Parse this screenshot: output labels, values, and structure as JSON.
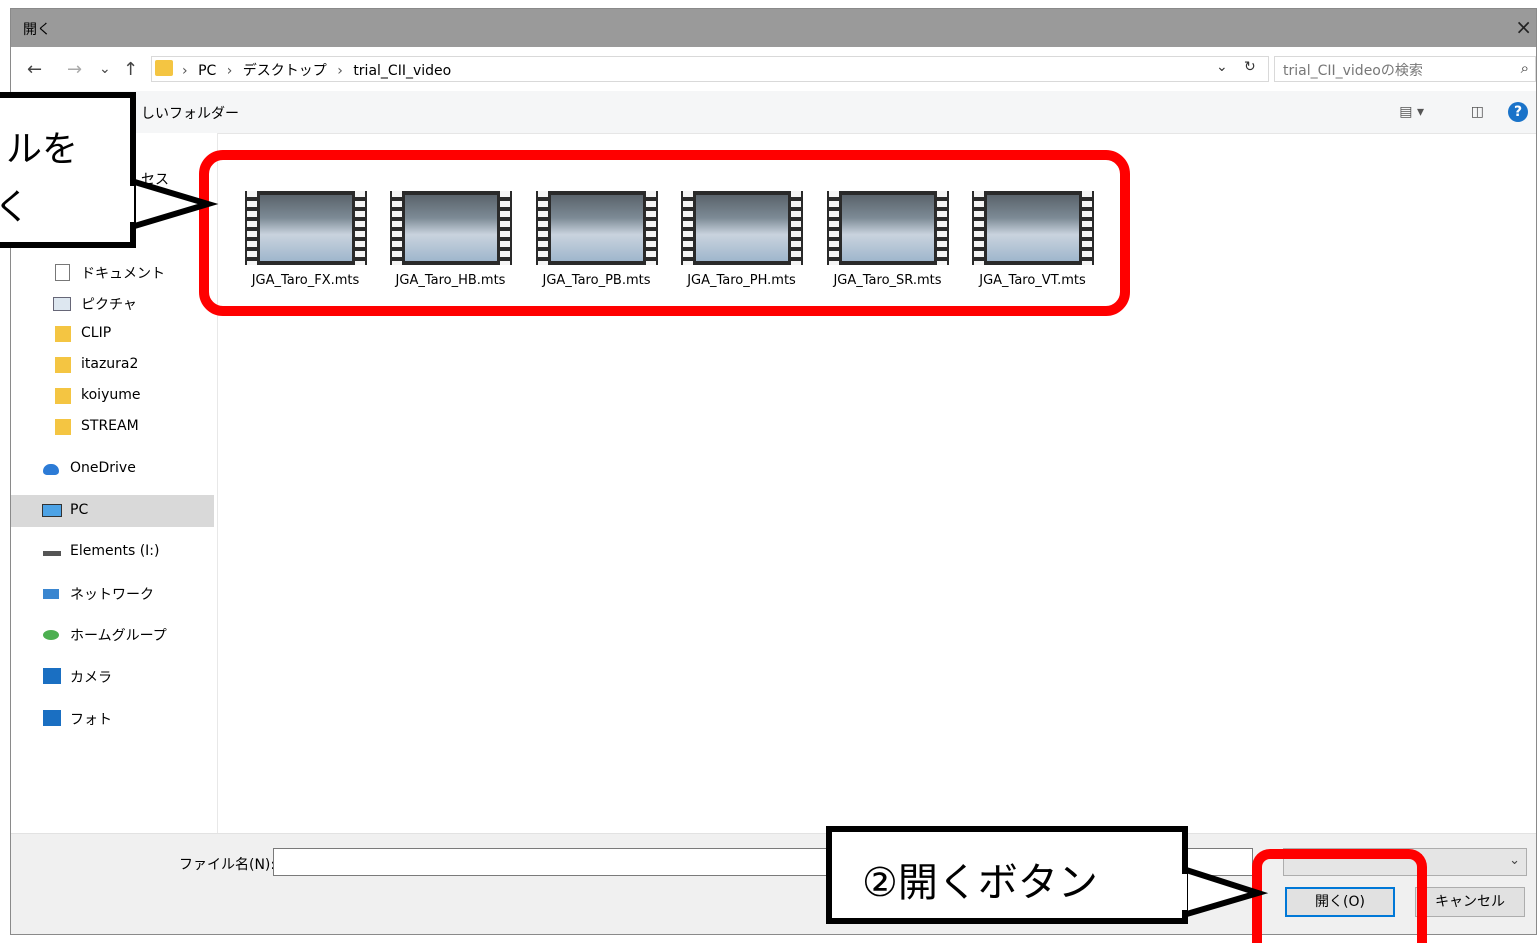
{
  "window": {
    "title": "開く",
    "close_icon": "×"
  },
  "nav": {
    "back": "←",
    "forward": "→",
    "recent": "⌄",
    "up": "↑",
    "breadcrumbs": [
      "PC",
      "デスクトップ",
      "trial_CII_video"
    ],
    "separator": "›",
    "dropdown": "⌄",
    "refresh": "↻",
    "search_placeholder": "trial_CII_videoの検索",
    "search_icon": "⌕"
  },
  "toolbar": {
    "new_folder": "しいフォルダー",
    "help": "?"
  },
  "sidebar": {
    "items": [
      {
        "label": "セス",
        "icon": "star-icon"
      },
      {
        "label": "ドキュメント",
        "icon": "document-icon"
      },
      {
        "label": "ピクチャ",
        "icon": "picture-icon"
      },
      {
        "label": "CLIP",
        "icon": "folder-icon"
      },
      {
        "label": "itazura2",
        "icon": "folder-icon"
      },
      {
        "label": "koiyume",
        "icon": "folder-icon"
      },
      {
        "label": "STREAM",
        "icon": "folder-icon"
      },
      {
        "label": "OneDrive",
        "icon": "onedrive-icon"
      },
      {
        "label": "PC",
        "icon": "pc-icon",
        "selected": true
      },
      {
        "label": "Elements (I:)",
        "icon": "drive-icon"
      },
      {
        "label": "ネットワーク",
        "icon": "network-icon"
      },
      {
        "label": "ホームグループ",
        "icon": "homegroup-icon"
      },
      {
        "label": "カメラ",
        "icon": "camera-icon"
      },
      {
        "label": "フォト",
        "icon": "photo-icon"
      }
    ]
  },
  "files": [
    {
      "name": "JGA_Taro_FX.mts"
    },
    {
      "name": "JGA_Taro_HB.mts"
    },
    {
      "name": "JGA_Taro_PB.mts"
    },
    {
      "name": "JGA_Taro_PH.mts"
    },
    {
      "name": "JGA_Taro_SR.mts"
    },
    {
      "name": "JGA_Taro_VT.mts"
    }
  ],
  "bottom": {
    "filename_label": "ファイル名(N):",
    "filename_value": "",
    "open_button": "開く(O)",
    "cancel_button": "キャンセル",
    "type_chevron": "⌄"
  },
  "annotations": {
    "callout1_line1": "ルを",
    "callout1_line2": "く",
    "callout2": "②開くボタン"
  },
  "colors": {
    "highlight": "#ff0000",
    "titlebar": "#9a9a9a",
    "accent": "#0078d7"
  }
}
